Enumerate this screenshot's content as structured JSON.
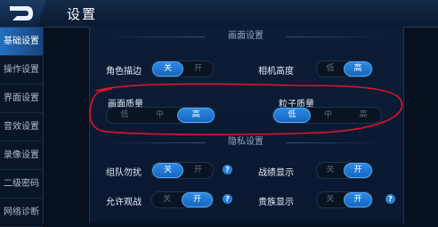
{
  "header": {
    "title": "设置"
  },
  "sidebar": {
    "items": [
      {
        "label": "基础设置",
        "active": true
      },
      {
        "label": "操作设置",
        "active": false
      },
      {
        "label": "界面设置",
        "active": false
      },
      {
        "label": "音效设置",
        "active": false
      },
      {
        "label": "录像设置",
        "active": false
      },
      {
        "label": "二级密码",
        "active": false
      },
      {
        "label": "网络诊断",
        "active": false
      }
    ]
  },
  "graphics": {
    "section_title": "画面设置",
    "character_outline": {
      "label": "角色描边",
      "options": [
        "关",
        "开"
      ],
      "selected": "关"
    },
    "camera_height": {
      "label": "相机高度",
      "options": [
        "低",
        "高"
      ],
      "selected": "高"
    },
    "graphics_quality": {
      "label": "画面质量",
      "options": [
        "低",
        "中",
        "高"
      ],
      "selected": "高"
    },
    "particle_quality": {
      "label": "粒子质量",
      "options": [
        "低",
        "中",
        "高"
      ],
      "selected": "低"
    }
  },
  "privacy": {
    "section_title": "隐私设置",
    "team_no_disturb": {
      "label": "组队勿扰",
      "options": [
        "关",
        "开"
      ],
      "selected": "关"
    },
    "record_display": {
      "label": "战绩显示",
      "options": [
        "关",
        "开"
      ],
      "selected": "开"
    },
    "allow_spectate": {
      "label": "允许观战",
      "options": [
        "关",
        "开"
      ],
      "selected": "开"
    },
    "noble_display": {
      "label": "贵族显示",
      "options": [
        "关",
        "开"
      ],
      "selected": "开"
    }
  },
  "colors": {
    "accent": "#2b8ae4",
    "annotation": "#e0142c"
  },
  "icons": {
    "back": "back-arrow-icon",
    "help": "question-mark-icon"
  }
}
